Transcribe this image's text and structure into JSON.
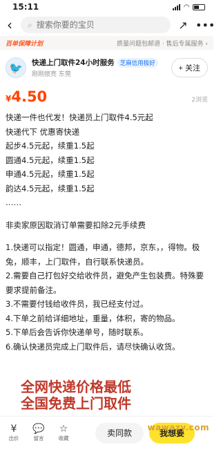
{
  "status": {
    "time": "15:11"
  },
  "nav": {
    "search_placeholder": "搜索你要的宝贝"
  },
  "banner": {
    "plan": "百单保障计划",
    "service": "质量问题包邮退 · 售后专属服务 ›"
  },
  "seller": {
    "name": "快递上门取件24小时服务",
    "credit_badge": "芝麻信用极好",
    "sub": "刚刚擦亮  东莞",
    "follow_label": "+ 关注"
  },
  "price": {
    "currency": "¥",
    "value": "4.50",
    "views": "2浏览"
  },
  "description": [
    "快递一件也代发！快递员上门取件4.5元起",
    "快递代下 优惠寄快递",
    "起步4.5元起，续重1.5起",
    "圆通4.5元起，续重1.5起",
    "申通4.5元起，续重1.5起",
    "韵达4.5元起，续重1.5起",
    "……",
    "",
    "非卖家原因取消订单需要扣除2元手续费",
    "",
    "1.快递可以指定！圆通，申通，德邦，京东，，得物。极兔，顺丰，上门取件，自行联系快递员。",
    "2.需要自己打包好交给收件员，避免产生包装费。特殊要要求提前备注。",
    "3.不需要付钱给收件员，我已经支付过。",
    "4.下单之前给详细地址，重量，体积，寄的物品。",
    "5.下单后会告诉你快递单号，随时联系。",
    "6.确认快递员完成上门取件后，请尽快确认收货。"
  ],
  "promo": {
    "line1": "全网快递价格最低",
    "line2": "全国免费上门取件"
  },
  "bottom": {
    "bid_label": "出价",
    "comment_label": "留言",
    "favorite_label": "收藏",
    "swap_label": "卖同款",
    "buy_label": "我想要"
  },
  "watermark": "wawazy.com",
  "colors": {
    "price": "#ff4400",
    "buy_button": "#ffe22b",
    "promo": "#c0392b"
  }
}
